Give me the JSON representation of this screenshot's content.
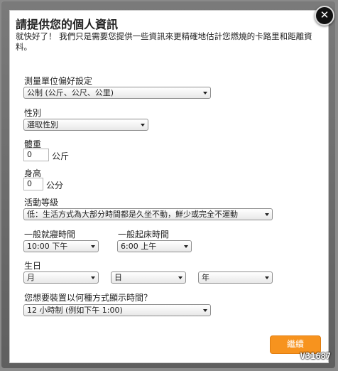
{
  "dialog": {
    "title": "請提供您的個人資訊",
    "intro": "就快好了！ 我們只是需要您提供一些資訊來更精確地估計您燃燒的卡路里和距離資料。",
    "close_glyph": "✕"
  },
  "fields": {
    "units": {
      "label": "測量單位偏好設定",
      "value": "公制 (公斤、公尺、公里)"
    },
    "gender": {
      "label": "性別",
      "value": "選取性別"
    },
    "weight": {
      "label": "體重",
      "value": "0",
      "unit": "公斤"
    },
    "height": {
      "label": "身高",
      "value": "0",
      "unit": "公分"
    },
    "activity": {
      "label": "活動等級",
      "value": "低：生活方式為大部分時間都是久坐不動，鮮少或完全不運動"
    },
    "bedtime": {
      "label": "一般就寢時間",
      "value": "10:00 下午"
    },
    "waketime": {
      "label": "一般起床時間",
      "value": "6:00 上午"
    },
    "birthday": {
      "label": "生日",
      "month": "月",
      "day": "日",
      "year": "年"
    },
    "time_format": {
      "label": "您想要裝置以何種方式顯示時間？",
      "value": "12 小時制 (例如下午 1:00)"
    }
  },
  "continue_button": {
    "label": "繼續",
    "color": "#f7931e"
  },
  "watermark": "V31687"
}
